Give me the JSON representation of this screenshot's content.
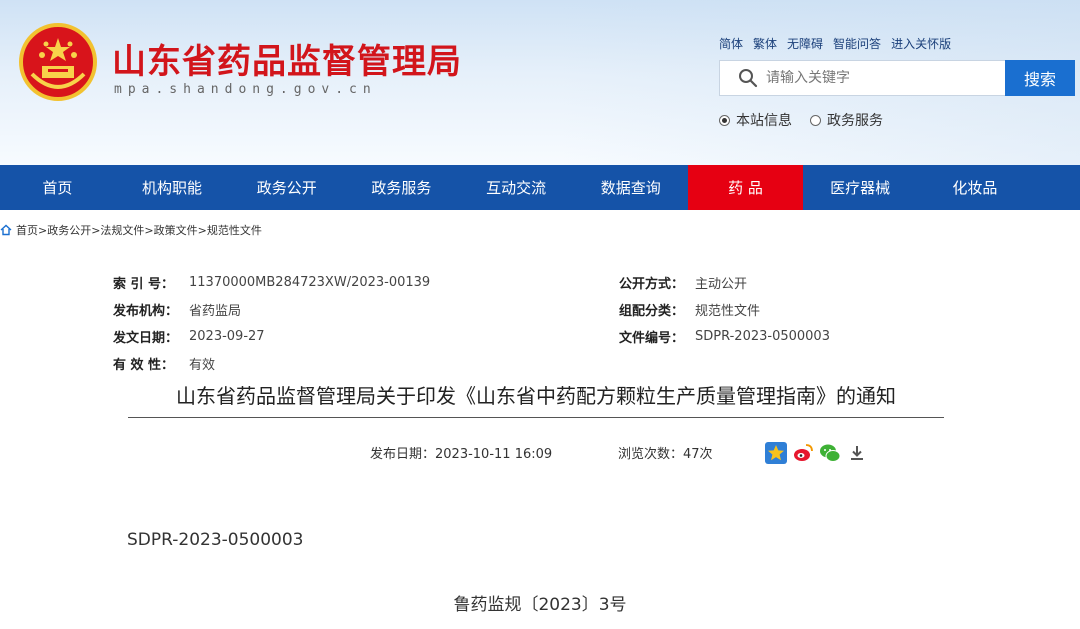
{
  "header": {
    "site_title": "山东省药品监督管理局",
    "site_domain": "mpa.shandong.gov.cn",
    "top_links": [
      "简体",
      "繁体",
      "无障碍",
      "智能问答",
      "进入关怀版"
    ],
    "search": {
      "placeholder": "请输入关键字",
      "button_label": "搜索"
    },
    "scope_options": [
      {
        "label": "本站信息",
        "selected": true
      },
      {
        "label": "政务服务",
        "selected": false
      }
    ],
    "colors": {
      "title": "#d2151b",
      "nav": "#1553a8",
      "nav_active": "#e60012",
      "search_button": "#1a6fd0"
    }
  },
  "nav": {
    "items": [
      {
        "label": "首页",
        "active": false
      },
      {
        "label": "机构职能",
        "active": false
      },
      {
        "label": "政务公开",
        "active": false
      },
      {
        "label": "政务服务",
        "active": false
      },
      {
        "label": "互动交流",
        "active": false
      },
      {
        "label": "数据查询",
        "active": false
      },
      {
        "label": "药 品",
        "active": true
      },
      {
        "label": "医疗器械",
        "active": false
      },
      {
        "label": "化妆品",
        "active": false
      }
    ]
  },
  "breadcrumb": {
    "text": "首页>政务公开>法规文件>政策文件>规范性文件"
  },
  "meta": {
    "left": [
      {
        "label": "索 引 号：",
        "value": "11370000MB284723XW/2023-00139"
      },
      {
        "label": "发布机构：",
        "value": "省药监局"
      },
      {
        "label": "发文日期：",
        "value": "2023-09-27"
      },
      {
        "label": "有 效 性：",
        "value": "有效"
      }
    ],
    "right": [
      {
        "label": "公开方式：",
        "value": "主动公开"
      },
      {
        "label": "组配分类：",
        "value": "规范性文件"
      },
      {
        "label": "文件编号：",
        "value": "SDPR-2023-0500003"
      }
    ]
  },
  "article": {
    "title": "山东省药品监督管理局关于印发《山东省中药配方颗粒生产质量管理指南》的通知",
    "publish_label": "发布日期：",
    "publish_date": "2023-10-11 16:09",
    "views_label": "浏览次数：",
    "views": "47次",
    "doc_number": "SDPR-2023-0500003",
    "doc_ref": "鲁药监规〔2023〕3号"
  },
  "share_icons": [
    "qzone-icon",
    "weibo-icon",
    "wechat-icon",
    "download-icon"
  ]
}
